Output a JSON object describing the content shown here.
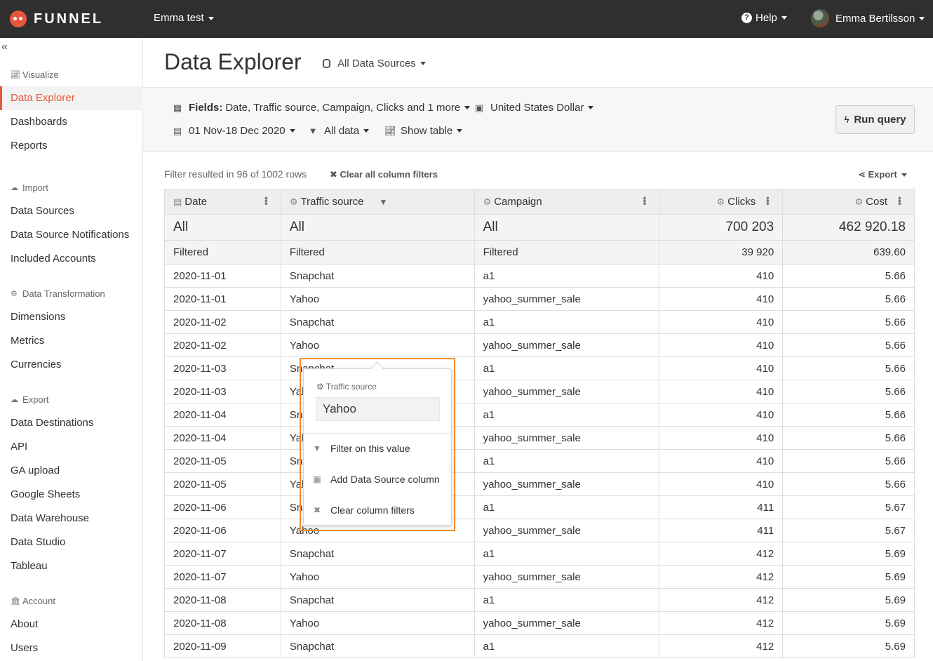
{
  "topbar": {
    "logo_text": "FUNNEL",
    "workspace": "Emma test",
    "help": "Help",
    "user_name": "Emma Bertilsson"
  },
  "sidebar": {
    "collapse_glyph": "«",
    "sections": [
      {
        "title": "Visualize",
        "items": [
          "Data Explorer",
          "Dashboards",
          "Reports"
        ]
      },
      {
        "title": "Import",
        "items": [
          "Data Sources",
          "Data Source Notifications",
          "Included Accounts"
        ]
      },
      {
        "title": "Data Transformation",
        "items": [
          "Dimensions",
          "Metrics",
          "Currencies"
        ]
      },
      {
        "title": "Export",
        "items": [
          "Data Destinations",
          "API",
          "GA upload",
          "Google Sheets",
          "Data Warehouse",
          "Data Studio",
          "Tableau"
        ]
      },
      {
        "title": "Account",
        "items": [
          "About",
          "Users"
        ]
      }
    ],
    "active_item": "Data Explorer"
  },
  "main": {
    "title": "Data Explorer",
    "source_select": "All Data Sources",
    "toolbar": {
      "fields_label": "Fields:",
      "fields_value": "Date, Traffic source, Campaign, Clicks and 1 more",
      "currency": "United States Dollar",
      "date_range": "01 Nov-18 Dec 2020",
      "data_filter": "All data",
      "view": "Show table",
      "run_query": "Run query"
    },
    "filter_info": "Filter resulted in 96 of 1002 rows",
    "clear_filters": "Clear all column filters",
    "export": "Export"
  },
  "table": {
    "columns": [
      "Date",
      "Traffic source",
      "Campaign",
      "Clicks",
      "Cost"
    ],
    "all_row": [
      "All",
      "All",
      "All",
      "700 203",
      "462 920.18"
    ],
    "filtered_row": [
      "Filtered",
      "Filtered",
      "Filtered",
      "39 920",
      "639.60"
    ],
    "rows": [
      [
        "2020-11-01",
        "Snapchat",
        "a1",
        "410",
        "5.66"
      ],
      [
        "2020-11-01",
        "Yahoo",
        "yahoo_summer_sale",
        "410",
        "5.66"
      ],
      [
        "2020-11-02",
        "Snapchat",
        "a1",
        "410",
        "5.66"
      ],
      [
        "2020-11-02",
        "Yahoo",
        "yahoo_summer_sale",
        "410",
        "5.66"
      ],
      [
        "2020-11-03",
        "Snapchat",
        "a1",
        "410",
        "5.66"
      ],
      [
        "2020-11-03",
        "Yahoo",
        "yahoo_summer_sale",
        "410",
        "5.66"
      ],
      [
        "2020-11-04",
        "Snapchat",
        "a1",
        "410",
        "5.66"
      ],
      [
        "2020-11-04",
        "Yahoo",
        "yahoo_summer_sale",
        "410",
        "5.66"
      ],
      [
        "2020-11-05",
        "Snapchat",
        "a1",
        "410",
        "5.66"
      ],
      [
        "2020-11-05",
        "Yahoo",
        "yahoo_summer_sale",
        "410",
        "5.66"
      ],
      [
        "2020-11-06",
        "Snapchat",
        "a1",
        "411",
        "5.67"
      ],
      [
        "2020-11-06",
        "Yahoo",
        "yahoo_summer_sale",
        "411",
        "5.67"
      ],
      [
        "2020-11-07",
        "Snapchat",
        "a1",
        "412",
        "5.69"
      ],
      [
        "2020-11-07",
        "Yahoo",
        "yahoo_summer_sale",
        "412",
        "5.69"
      ],
      [
        "2020-11-08",
        "Snapchat",
        "a1",
        "412",
        "5.69"
      ],
      [
        "2020-11-08",
        "Yahoo",
        "yahoo_summer_sale",
        "412",
        "5.69"
      ],
      [
        "2020-11-09",
        "Snapchat",
        "a1",
        "412",
        "5.69"
      ]
    ]
  },
  "popover": {
    "label": "Traffic source",
    "value": "Yahoo",
    "items": [
      "Filter on this value",
      "Add Data Source column",
      "Clear column filters"
    ]
  },
  "colors": {
    "topbar": "#2f2f2f",
    "accent": "#e8573b",
    "highlight": "#f0892e"
  }
}
